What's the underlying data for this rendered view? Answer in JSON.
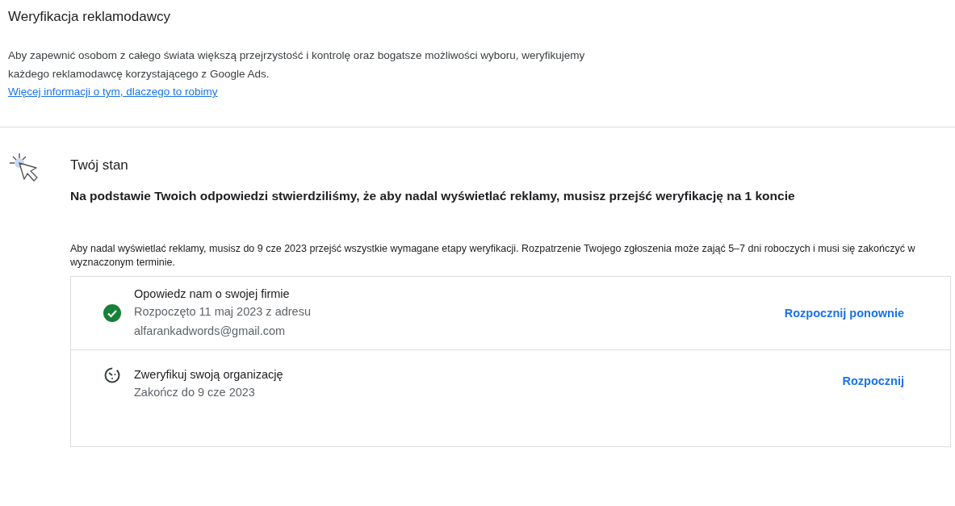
{
  "header": {
    "title": "Weryfikacja reklamodawcy",
    "description": "Aby zapewnić osobom z całego świata większą przejrzystość i kontrolę oraz bogatsze możliwości wyboru, weryfikujemy każdego reklamodawcę korzystającego z Google Ads.",
    "link": "Więcej informacji o tym, dlaczego to robimy"
  },
  "status": {
    "title": "Twój stan",
    "summary": "Na podstawie Twoich odpowiedzi stwierdziliśmy, że aby nadal wyświetlać reklamy, musisz przejść weryfikację na 1 koncie",
    "note": "Aby nadal wyświetlać reklamy, musisz do 9 cze 2023 przejść wszystkie wymagane etapy weryfikacji. Rozpatrzenie Twojego zgłoszenia może zająć 5–7 dni roboczych i musi się zakończyć w wyznaczonym terminie."
  },
  "steps": [
    {
      "kind": "done",
      "title": "Opowiedz nam o swojej firmie",
      "details": [
        "Rozpoczęto 11 maj 2023 z adresu",
        "alfarankadwords@gmail.com"
      ],
      "action": "Rozpocznij ponownie"
    },
    {
      "kind": "pending",
      "title": "Zweryfikuj swoją organizację",
      "details": [
        "Zakończ do 9 cze 2023"
      ],
      "action": "Rozpocznij"
    }
  ]
}
